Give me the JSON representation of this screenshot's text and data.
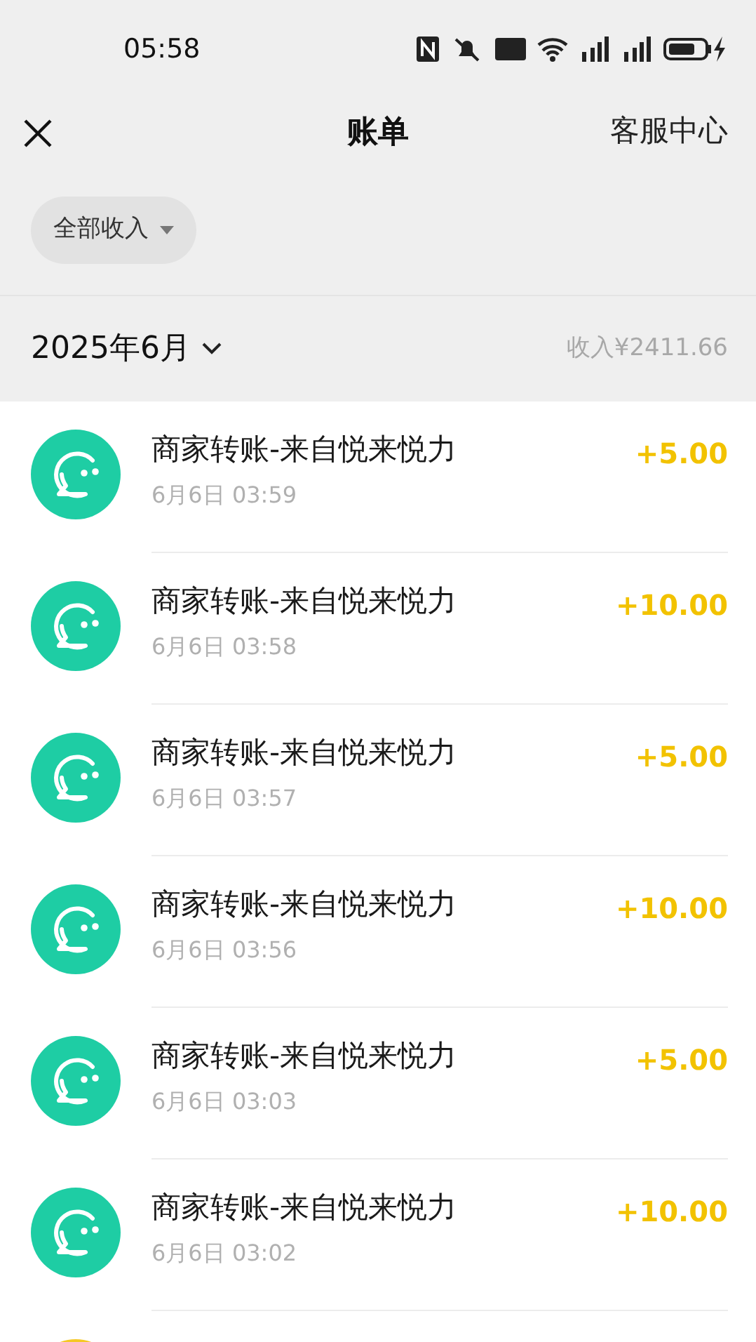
{
  "status_bar": {
    "time": "05:58"
  },
  "header": {
    "title": "账单",
    "action": "客服中心"
  },
  "filter": {
    "label": "全部收入"
  },
  "month": {
    "label": "2025年6月",
    "summary": "收入¥2411.66"
  },
  "transactions": [
    {
      "title": "商家转账-来自悦来悦力",
      "time": "6月6日 03:59",
      "amount": "+5.00",
      "color": "#1ecda4"
    },
    {
      "title": "商家转账-来自悦来悦力",
      "time": "6月6日 03:58",
      "amount": "+10.00",
      "color": "#1ecda4"
    },
    {
      "title": "商家转账-来自悦来悦力",
      "time": "6月6日 03:57",
      "amount": "+5.00",
      "color": "#1ecda4"
    },
    {
      "title": "商家转账-来自悦来悦力",
      "time": "6月6日 03:56",
      "amount": "+10.00",
      "color": "#1ecda4"
    },
    {
      "title": "商家转账-来自悦来悦力",
      "time": "6月6日 03:03",
      "amount": "+5.00",
      "color": "#1ecda4"
    },
    {
      "title": "商家转账-来自悦来悦力",
      "time": "6月6日 03:02",
      "amount": "+10.00",
      "color": "#1ecda4"
    },
    {
      "color": "#f5c825"
    }
  ]
}
